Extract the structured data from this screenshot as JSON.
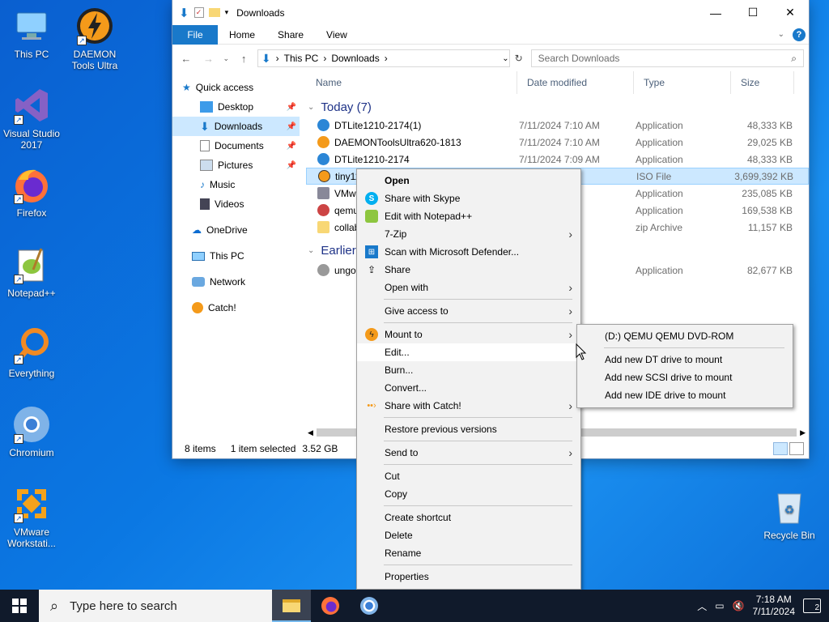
{
  "desktop": {
    "icons": [
      {
        "label": "This PC"
      },
      {
        "label": "DAEMON Tools Ultra"
      },
      {
        "label": "Visual Studio 2017"
      },
      {
        "label": "Firefox"
      },
      {
        "label": "Notepad++"
      },
      {
        "label": "Everything"
      },
      {
        "label": "Chromium"
      },
      {
        "label": "VMware Workstati..."
      },
      {
        "label": "Recycle Bin"
      }
    ]
  },
  "explorer": {
    "title": "Downloads",
    "ribbon_tabs": [
      "File",
      "Home",
      "Share",
      "View"
    ],
    "address": {
      "segments": [
        "This PC",
        "Downloads"
      ]
    },
    "search_placeholder": "Search Downloads",
    "nav": [
      {
        "label": "Quick access"
      },
      {
        "label": "Desktop"
      },
      {
        "label": "Downloads"
      },
      {
        "label": "Documents"
      },
      {
        "label": "Pictures"
      },
      {
        "label": "Music"
      },
      {
        "label": "Videos"
      },
      {
        "label": "OneDrive"
      },
      {
        "label": "This PC"
      },
      {
        "label": "Network"
      },
      {
        "label": "Catch!"
      }
    ],
    "columns": [
      "Name",
      "Date modified",
      "Type",
      "Size"
    ],
    "groups": [
      {
        "label": "Today (7)"
      },
      {
        "label": "Earlier"
      }
    ],
    "files": [
      {
        "name": "DTLite1210-2174(1)",
        "date": "7/11/2024 7:10 AM",
        "type": "Application",
        "size": "48,333 KB"
      },
      {
        "name": "DAEMONToolsUltra620-1813",
        "date": "7/11/2024 7:10 AM",
        "type": "Application",
        "size": "29,025 KB"
      },
      {
        "name": "DTLite1210-2174",
        "date": "7/11/2024 7:09 AM",
        "type": "Application",
        "size": "48,333 KB"
      },
      {
        "name": "tiny11",
        "date": "06 AM",
        "type": "ISO File",
        "size": "3,699,392 KB"
      },
      {
        "name": "VMw",
        "date": "58 AM",
        "type": "Application",
        "size": "235,085 KB"
      },
      {
        "name": "qemu",
        "date": "41 AM",
        "type": "Application",
        "size": "169,538 KB"
      },
      {
        "name": "collab",
        "date": "40 AM",
        "type": "zip Archive",
        "size": "11,157 KB"
      },
      {
        "name": "ungo",
        "date": "53 PM",
        "type": "Application",
        "size": "82,677 KB"
      }
    ],
    "status": {
      "items": "8 items",
      "selected": "1 item selected",
      "size": "3.52 GB"
    }
  },
  "context_menu": {
    "items": [
      {
        "label": "Open"
      },
      {
        "label": "Share with Skype"
      },
      {
        "label": "Edit with Notepad++"
      },
      {
        "label": "7-Zip"
      },
      {
        "label": "Scan with Microsoft Defender..."
      },
      {
        "label": "Share"
      },
      {
        "label": "Open with"
      },
      {
        "label": "Give access to"
      },
      {
        "label": "Mount to"
      },
      {
        "label": "Edit..."
      },
      {
        "label": "Burn..."
      },
      {
        "label": "Convert..."
      },
      {
        "label": "Share with Catch!"
      },
      {
        "label": "Restore previous versions"
      },
      {
        "label": "Send to"
      },
      {
        "label": "Cut"
      },
      {
        "label": "Copy"
      },
      {
        "label": "Create shortcut"
      },
      {
        "label": "Delete"
      },
      {
        "label": "Rename"
      },
      {
        "label": "Properties"
      }
    ]
  },
  "submenu": {
    "items": [
      {
        "label": "(D:) QEMU QEMU DVD-ROM"
      },
      {
        "label": "Add new DT drive to mount"
      },
      {
        "label": "Add new SCSI drive to mount"
      },
      {
        "label": "Add new IDE drive to mount"
      }
    ]
  },
  "taskbar": {
    "search_placeholder": "Type here to search",
    "time": "7:18 AM",
    "date": "7/11/2024",
    "notification_count": "2"
  },
  "colors": {
    "accent": "#1979ca",
    "selection": "#cce8ff",
    "desktop": "#0b78e3",
    "taskbar": "#101a2b"
  }
}
